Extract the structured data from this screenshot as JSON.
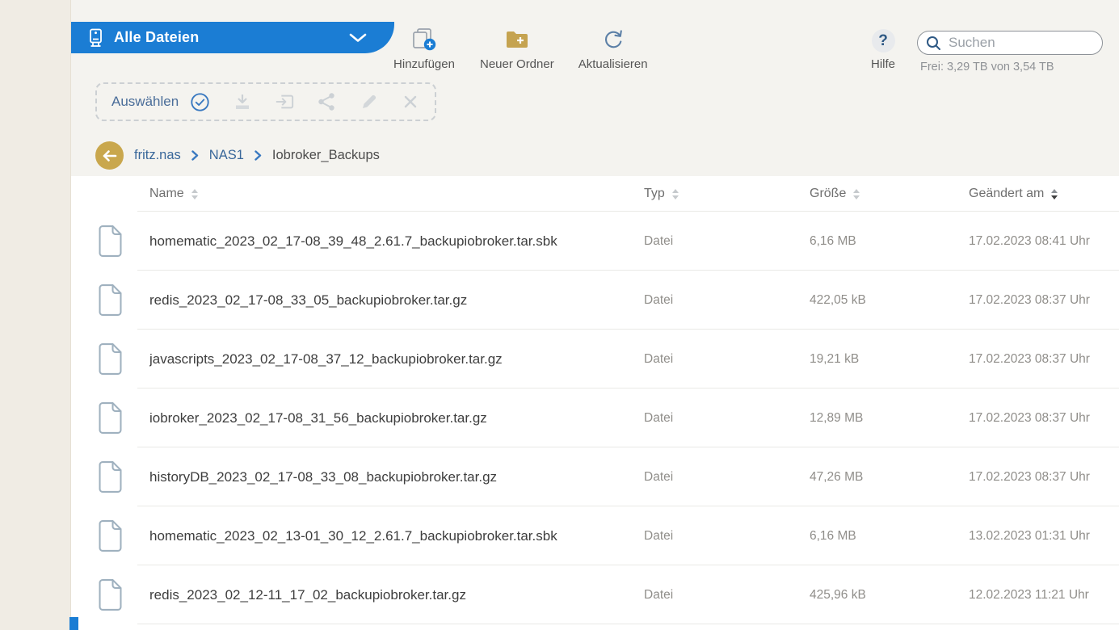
{
  "header": {
    "tab_label": "Alle Dateien",
    "actions": [
      {
        "id": "add",
        "label": "Hinzufügen"
      },
      {
        "id": "new-folder",
        "label": "Neuer Ordner"
      },
      {
        "id": "refresh",
        "label": "Aktualisieren"
      }
    ],
    "help_label": "Hilfe",
    "help_glyph": "?",
    "search_placeholder": "Suchen",
    "storage_free": "Frei: 3,29 TB von 3,54 TB"
  },
  "selection_toolbar": {
    "label": "Auswählen",
    "icons": [
      "check-circle-icon",
      "download-icon",
      "move-to-folder-icon",
      "share-icon",
      "edit-icon",
      "delete-icon"
    ]
  },
  "breadcrumb": {
    "items": [
      "fritz.nas",
      "NAS1",
      "Iobroker_Backups"
    ]
  },
  "table": {
    "columns": [
      {
        "key": "name",
        "label": "Name",
        "sorted": false
      },
      {
        "key": "typ",
        "label": "Typ",
        "sorted": false
      },
      {
        "key": "groesse",
        "label": "Größe",
        "sorted": false
      },
      {
        "key": "geaendert",
        "label": "Geändert am",
        "sorted": true,
        "sort_dir": "desc"
      }
    ],
    "rows": [
      {
        "name": "homematic_2023_02_17-08_39_48_2.61.7_backupiobroker.tar.sbk",
        "type": "Datei",
        "size": "6,16 MB",
        "modified": "17.02.2023 08:41 Uhr"
      },
      {
        "name": "redis_2023_02_17-08_33_05_backupiobroker.tar.gz",
        "type": "Datei",
        "size": "422,05 kB",
        "modified": "17.02.2023 08:37 Uhr"
      },
      {
        "name": "javascripts_2023_02_17-08_37_12_backupiobroker.tar.gz",
        "type": "Datei",
        "size": "19,21 kB",
        "modified": "17.02.2023 08:37 Uhr"
      },
      {
        "name": "iobroker_2023_02_17-08_31_56_backupiobroker.tar.gz",
        "type": "Datei",
        "size": "12,89 MB",
        "modified": "17.02.2023 08:37 Uhr"
      },
      {
        "name": "historyDB_2023_02_17-08_33_08_backupiobroker.tar.gz",
        "type": "Datei",
        "size": "47,26 MB",
        "modified": "17.02.2023 08:37 Uhr"
      },
      {
        "name": "homematic_2023_02_13-01_30_12_2.61.7_backupiobroker.tar.sbk",
        "type": "Datei",
        "size": "6,16 MB",
        "modified": "13.02.2023 01:31 Uhr"
      },
      {
        "name": "redis_2023_02_12-11_17_02_backupiobroker.tar.gz",
        "type": "Datei",
        "size": "425,96 kB",
        "modified": "12.02.2023 11:21 Uhr"
      }
    ]
  },
  "colors": {
    "accent_blue": "#1b7dd4",
    "gold": "#c9a74d",
    "link_blue": "#39679a",
    "muted_text": "#908e8a"
  }
}
